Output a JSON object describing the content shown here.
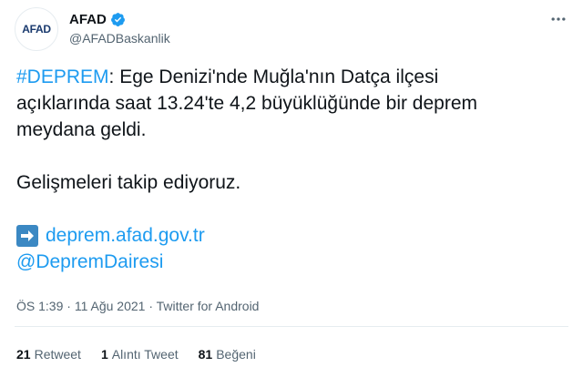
{
  "account": {
    "avatar_text": "AFAD",
    "display_name": "AFAD",
    "handle": "@AFADBaskanlik",
    "verified": true
  },
  "tweet": {
    "hashtag": "#DEPREM",
    "text_line1_rest": ": Ege Denizi'nde Muğla'nın Datça ilçesi",
    "text_line2": "açıklarında saat 13.24'te 4,2 büyüklüğünde bir deprem",
    "text_line3": "meydana geldi.",
    "text_line4": "Gelişmeleri takip ediyoruz.",
    "link_icon": "right-arrow-icon",
    "link": "deprem.afad.gov.tr",
    "mention": "@DepremDairesi"
  },
  "meta": {
    "time": "ÖS 1:39",
    "separator1": " · ",
    "date": "11 Ağu 2021",
    "separator2": " · ",
    "source": "Twitter for Android"
  },
  "stats": {
    "retweets_count": "21",
    "retweets_label": "Retweet",
    "quotes_count": "1",
    "quotes_label": "Alıntı Tweet",
    "likes_count": "81",
    "likes_label": "Beğeni"
  },
  "colors": {
    "link": "#1d9bf0",
    "secondary_text": "#536471",
    "primary_text": "#0f1419",
    "arrow_box": "#3b88c3",
    "avatar_text": "#1a3a6e"
  }
}
